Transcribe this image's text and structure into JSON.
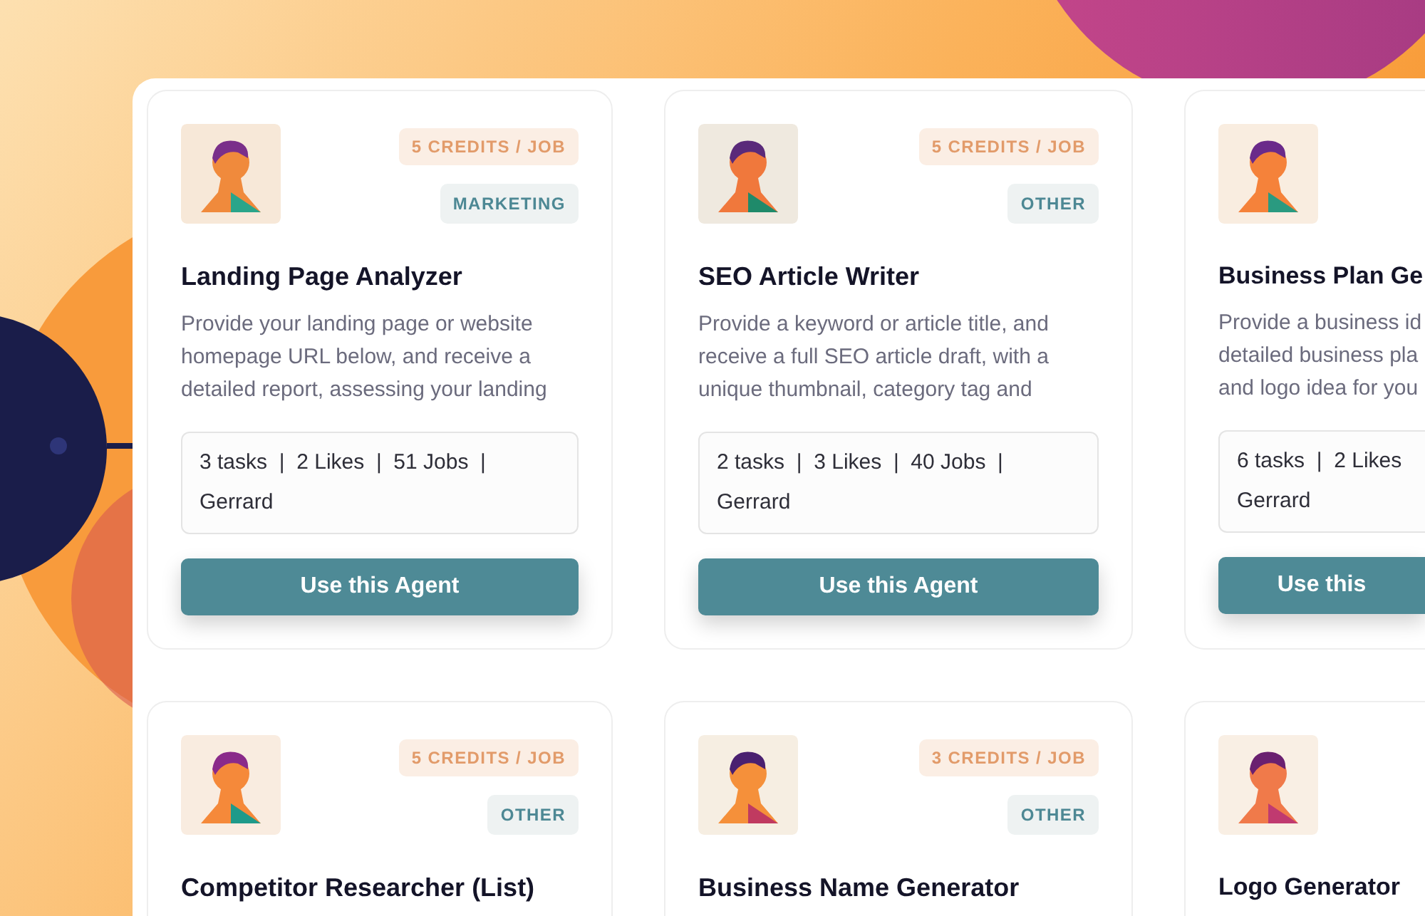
{
  "cards": [
    {
      "credits": "5 CREDITS / JOB",
      "category": "MARKETING",
      "title": "Landing Page Analyzer",
      "description_lines": [
        "Provide your landing page or website",
        "homepage URL below, and receive a",
        "detailed report, assessing your landing"
      ],
      "stats_lines": [
        "3 tasks  |  2 Likes  |  51 Jobs  |",
        "Gerrard"
      ],
      "button": "Use this Agent"
    },
    {
      "credits": "5 CREDITS / JOB",
      "category": "OTHER",
      "title": "SEO Article Writer",
      "description_lines": [
        "Provide a keyword or article title, and",
        "receive a full SEO article draft, with a",
        "unique thumbnail, category tag and"
      ],
      "stats_lines": [
        "2 tasks  |  3 Likes  |  40 Jobs  |",
        "Gerrard"
      ],
      "button": "Use this Agent"
    },
    {
      "title": "Business Plan Ge",
      "description_lines": [
        "Provide a business id",
        "detailed business pla",
        "and logo idea for you"
      ],
      "stats_lines": [
        "6 tasks  |  2 Likes",
        "Gerrard"
      ],
      "button": "Use this"
    },
    {
      "credits": "5 CREDITS / JOB",
      "category": "OTHER",
      "title": "Competitor Researcher (List)"
    },
    {
      "credits": "3 CREDITS / JOB",
      "category": "OTHER",
      "title": "Business Name Generator"
    },
    {
      "title": "Logo Generator"
    }
  ]
}
